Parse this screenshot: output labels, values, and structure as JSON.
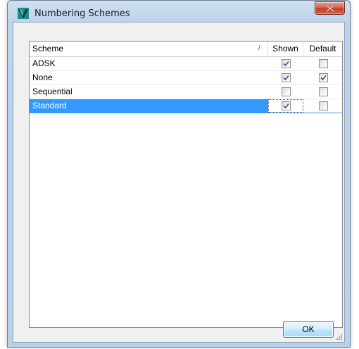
{
  "window": {
    "title": "Numbering Schemes",
    "close_label": "x"
  },
  "grid": {
    "columns": {
      "scheme": "Scheme",
      "sort_indicator": "/",
      "shown": "Shown",
      "default": "Default"
    },
    "rows": [
      {
        "scheme": "ADSK",
        "shown": true,
        "default": false,
        "selected": false
      },
      {
        "scheme": "None",
        "shown": true,
        "default": true,
        "selected": false
      },
      {
        "scheme": "Sequential",
        "shown": false,
        "default": false,
        "selected": false
      },
      {
        "scheme": "Standard",
        "shown": true,
        "default": false,
        "selected": true
      }
    ]
  },
  "buttons": {
    "ok_label": "OK"
  },
  "colors": {
    "selection": "#3399ff",
    "title_gradient": "#bcd3ea",
    "close_button": "#c2402a",
    "app_icon": "#1b8f88"
  }
}
